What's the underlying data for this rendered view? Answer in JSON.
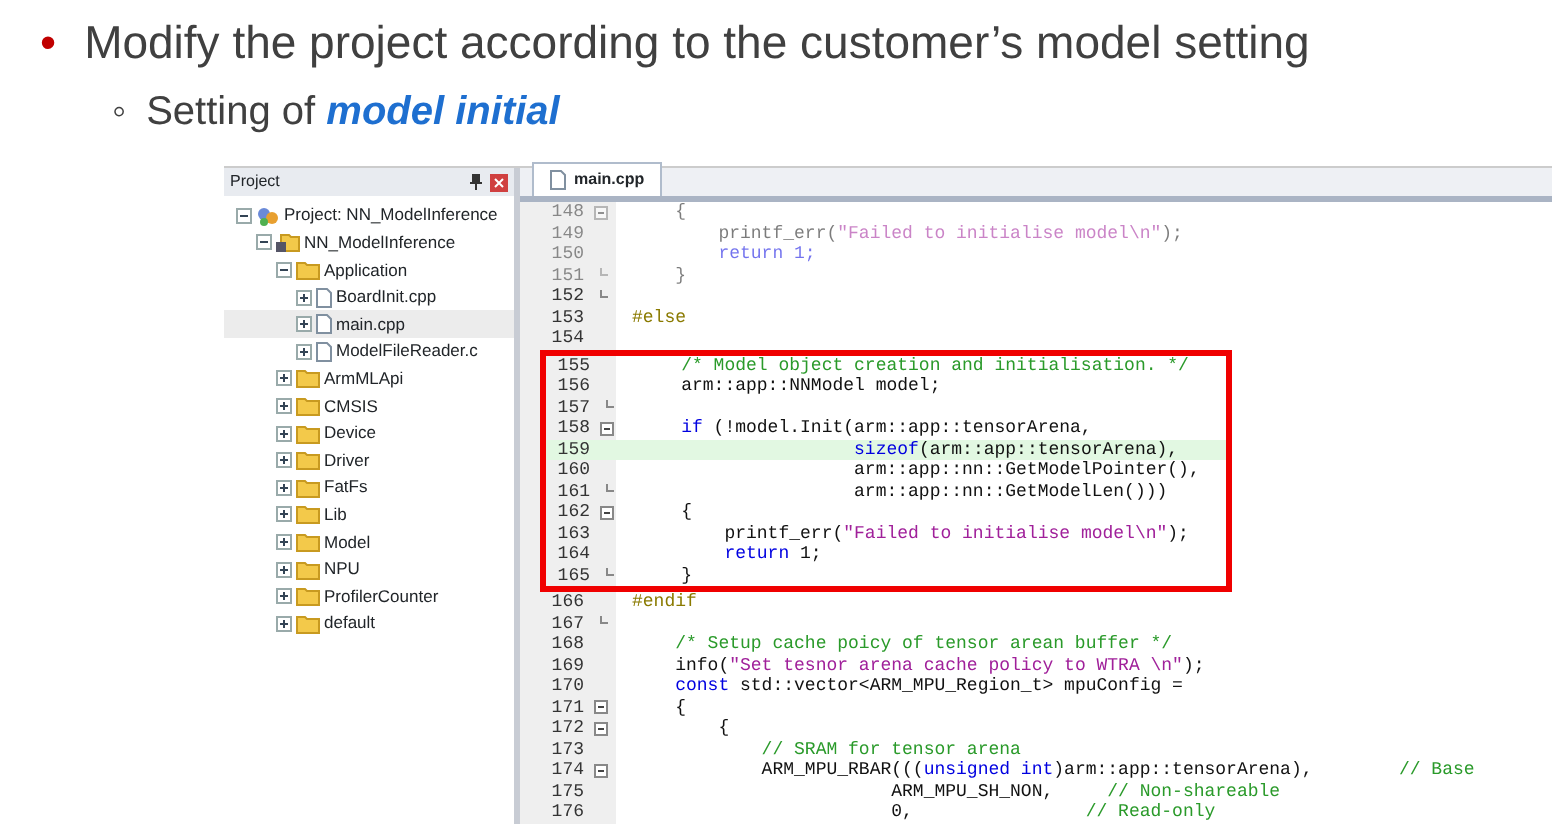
{
  "slide": {
    "bullet": {
      "marker": "•",
      "text": "Modify the project according to the customer’s model setting"
    },
    "sub_bullet": {
      "marker": "◦",
      "text": "Setting of *model initial*"
    }
  },
  "project_panel": {
    "title": "Project",
    "tree": [
      {
        "label": "Project: NN_ModelInference",
        "kind": "project",
        "expanded": true,
        "selected": false,
        "children": [
          {
            "label": "NN_ModelInference",
            "kind": "target",
            "expanded": true,
            "selected": false,
            "children": [
              {
                "label": "Application",
                "kind": "folder",
                "expanded": true,
                "selected": false,
                "children": [
                  {
                    "label": "BoardInit.cpp",
                    "kind": "file",
                    "expanded": false,
                    "selected": false
                  },
                  {
                    "label": "main.cpp",
                    "kind": "file",
                    "expanded": false,
                    "selected": true
                  },
                  {
                    "label": "ModelFileReader.c",
                    "kind": "file",
                    "expanded": false,
                    "selected": false
                  }
                ]
              },
              {
                "label": "ArmMLApi",
                "kind": "folder",
                "expanded": false,
                "selected": false
              },
              {
                "label": "CMSIS",
                "kind": "folder",
                "expanded": false,
                "selected": false
              },
              {
                "label": "Device",
                "kind": "folder",
                "expanded": false,
                "selected": false
              },
              {
                "label": "Driver",
                "kind": "folder",
                "expanded": false,
                "selected": false
              },
              {
                "label": "FatFs",
                "kind": "folder",
                "expanded": false,
                "selected": false
              },
              {
                "label": "Lib",
                "kind": "folder",
                "expanded": false,
                "selected": false
              },
              {
                "label": "Model",
                "kind": "folder",
                "expanded": false,
                "selected": false
              },
              {
                "label": "NPU",
                "kind": "folder",
                "expanded": false,
                "selected": false
              },
              {
                "label": "ProfilerCounter",
                "kind": "folder",
                "expanded": false,
                "selected": false
              },
              {
                "label": "default",
                "kind": "folder",
                "expanded": false,
                "selected": false
              }
            ]
          }
        ]
      }
    ]
  },
  "editor": {
    "tabs": [
      {
        "label": "main.cpp",
        "selected": true
      }
    ],
    "blocks": [
      {
        "kind": "plain",
        "lines": [
          {
            "number": "148",
            "foldable": true,
            "inactive": true,
            "tokens": [
              {
                "kind": "plain",
                "text": "    {"
              }
            ]
          },
          {
            "number": "149",
            "inactive": true,
            "tokens": [
              {
                "kind": "plain",
                "text": "        printf_err("
              },
              {
                "kind": "string",
                "text": "\"Failed to initialise model\\n\""
              },
              {
                "kind": "plain",
                "text": ");"
              }
            ]
          },
          {
            "number": "150",
            "inactive": true,
            "tokens": [
              {
                "kind": "keyword",
                "text": "        return 1;"
              }
            ]
          },
          {
            "number": "151",
            "fold_end": true,
            "inactive": true,
            "tokens": [
              {
                "kind": "plain",
                "text": "    }"
              }
            ]
          },
          {
            "number": "152",
            "fold_end": true
          },
          {
            "number": "153",
            "tokens": [
              {
                "kind": "preproc",
                "text": "#else"
              }
            ]
          },
          {
            "number": "154"
          }
        ]
      },
      {
        "kind": "highlight",
        "lines": [
          {
            "number": "155",
            "tokens": [
              {
                "kind": "comment",
                "text": "    /* Model object creation and initialisation. */"
              }
            ]
          },
          {
            "number": "156",
            "tokens": [
              {
                "kind": "plain",
                "text": "    arm::app::NNModel model;"
              }
            ]
          },
          {
            "number": "157",
            "fold_end": true
          },
          {
            "number": "158",
            "foldable": true,
            "tokens": [
              {
                "kind": "keyword",
                "text": "    if"
              },
              {
                "kind": "plain",
                "text": " (!model.Init(arm::app::tensorArena,"
              }
            ]
          },
          {
            "number": "159",
            "current": true,
            "tokens": [
              {
                "kind": "keyword",
                "text": "                    sizeof"
              },
              {
                "kind": "plain",
                "text": "(arm::app::tensorArena),"
              }
            ]
          },
          {
            "number": "160",
            "tokens": [
              {
                "kind": "plain",
                "text": "                    arm::app::nn::GetModelPointer(),"
              }
            ]
          },
          {
            "number": "161",
            "fold_end": true,
            "tokens": [
              {
                "kind": "plain",
                "text": "                    arm::app::nn::GetModelLen()))"
              }
            ]
          },
          {
            "number": "162",
            "foldable": true,
            "tokens": [
              {
                "kind": "plain",
                "text": "    {"
              }
            ]
          },
          {
            "number": "163",
            "tokens": [
              {
                "kind": "plain",
                "text": "        printf_err("
              },
              {
                "kind": "string",
                "text": "\"Failed to initialise model\\n\""
              },
              {
                "kind": "plain",
                "text": ");"
              }
            ]
          },
          {
            "number": "164",
            "tokens": [
              {
                "kind": "keyword",
                "text": "        return"
              },
              {
                "kind": "plain",
                "text": " 1;"
              }
            ]
          },
          {
            "number": "165",
            "fold_end": true,
            "tokens": [
              {
                "kind": "plain",
                "text": "    }"
              }
            ]
          }
        ]
      },
      {
        "kind": "plain",
        "lines": [
          {
            "number": "166",
            "tokens": [
              {
                "kind": "preproc",
                "text": "#endif"
              }
            ]
          },
          {
            "number": "167",
            "fold_end": true
          },
          {
            "number": "168",
            "tokens": [
              {
                "kind": "comment",
                "text": "    /* Setup cache poicy of tensor arean buffer */"
              }
            ]
          },
          {
            "number": "169",
            "tokens": [
              {
                "kind": "plain",
                "text": "    info("
              },
              {
                "kind": "string",
                "text": "\"Set tesnor arena cache policy to WTRA \\n\""
              },
              {
                "kind": "plain",
                "text": ");"
              }
            ]
          },
          {
            "number": "170",
            "tokens": [
              {
                "kind": "keyword",
                "text": "    const"
              },
              {
                "kind": "plain",
                "text": " std::vector<ARM_MPU_Region_t> mpuConfig ="
              }
            ]
          },
          {
            "number": "171",
            "foldable": true,
            "tokens": [
              {
                "kind": "plain",
                "text": "    {"
              }
            ]
          },
          {
            "number": "172",
            "foldable": true,
            "tokens": [
              {
                "kind": "plain",
                "text": "        {"
              }
            ]
          },
          {
            "number": "173",
            "tokens": [
              {
                "kind": "comment",
                "text": "            // SRAM for tensor arena"
              }
            ]
          },
          {
            "number": "174",
            "foldable": true,
            "tokens": [
              {
                "kind": "plain",
                "text": "            ARM_MPU_RBAR((("
              },
              {
                "kind": "keyword",
                "text": "unsigned int"
              },
              {
                "kind": "plain",
                "text": ")arm::app::tensorArena),        "
              },
              {
                "kind": "comment",
                "text": "// Base"
              }
            ]
          },
          {
            "number": "175",
            "tokens": [
              {
                "kind": "plain",
                "text": "                        ARM_MPU_SH_NON,     "
              },
              {
                "kind": "comment",
                "text": "// Non-shareable"
              }
            ]
          },
          {
            "number": "176",
            "tokens": [
              {
                "kind": "plain",
                "text": "                        0,                "
              },
              {
                "kind": "comment",
                "text": "// Read-only"
              }
            ]
          }
        ]
      }
    ]
  }
}
